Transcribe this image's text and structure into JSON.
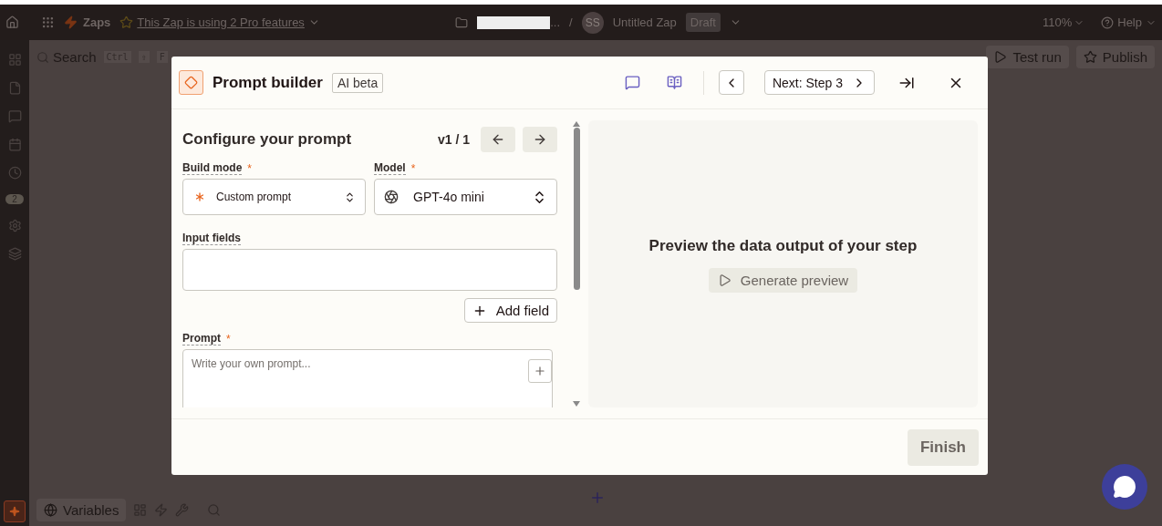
{
  "topbar": {
    "app_label": "Zaps",
    "pro_notice": "This Zap is using 2 Pro features",
    "breadcrumb_ellipsis": "...",
    "separator": "/",
    "avatar_initials": "SS",
    "zap_name": "Untitled Zap",
    "status_badge": "Draft",
    "zoom": "110%",
    "help": "Help"
  },
  "sidebar": {
    "items": [
      {
        "kind": "apps"
      },
      {
        "kind": "file"
      },
      {
        "kind": "chat"
      },
      {
        "kind": "calendar"
      },
      {
        "kind": "history"
      },
      {
        "kind": "badge",
        "badge": "2"
      },
      {
        "kind": "settings"
      },
      {
        "kind": "layers"
      }
    ]
  },
  "canvas_toolbar": {
    "search": "Search",
    "shortcut_keys": [
      "Ctrl",
      "⇧",
      "F"
    ],
    "buttons": [
      {
        "kind": "test",
        "label": "Test run"
      },
      {
        "kind": "publish",
        "label": "Publish"
      }
    ]
  },
  "bottom_toolbar": {
    "variables": "Variables"
  },
  "modal": {
    "title": "Prompt builder",
    "badge": "AI beta",
    "next_button": "Next: Step 3",
    "section_title": "Configure your prompt",
    "version": "v1 / 1",
    "fields": [
      {
        "kind": "select",
        "label": "Build mode",
        "required_mark": "*",
        "value": "Custom prompt"
      },
      {
        "kind": "select",
        "label": "Model",
        "required_mark": "*",
        "value": "GPT-4o mini"
      },
      {
        "kind": "list",
        "label": "Input fields",
        "button": "Add field"
      },
      {
        "kind": "textarea",
        "label": "Prompt",
        "required_mark": "*",
        "placeholder": "Write your own prompt..."
      }
    ],
    "preview": {
      "heading": "Preview the data output of your step",
      "button": "Generate preview",
      "disabled": true
    },
    "finish": {
      "label": "Finish",
      "disabled": true
    }
  }
}
